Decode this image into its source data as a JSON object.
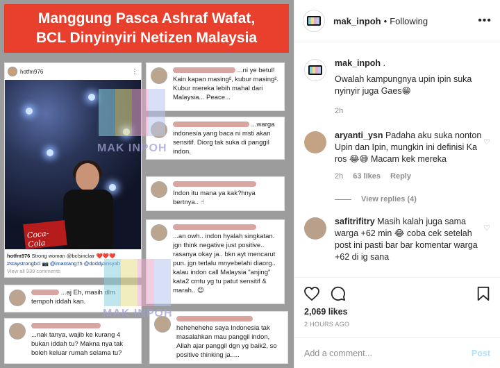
{
  "banner": {
    "line1": "Manggung Pasca Ashraf Wafat,",
    "line2": "BCL Dinyinyiri Netizen Malaysia"
  },
  "embedded_post": {
    "username": "hotfm976",
    "caption_user": "hotfm976",
    "caption_text": "Strong woman @bclsinclair ❤️❤️❤️",
    "caption_tags": "#staystrongbcl 📷 @imantang75 @doddyansyah",
    "view_all": "View all 939 comments",
    "brand_text": "Coca-Cola"
  },
  "embedded_comments": [
    {
      "text": "...ni ye betul! Kain kapan masing², kubur masing². Kubur mereka lebih mahal dari Malaysia... Peace..."
    },
    {
      "text": "...warga indonesia yang baca ni msti akan sensitif. Diorg tak suka di panggil indon."
    },
    {
      "text": "Indon itu mana ya kak?hnya bertnya.. ☝"
    },
    {
      "text": "...an owh.. indon hyalah singkatan. jgn think negative just positive.. rasanya okay ja.. bkn ayt mencarut pun. jgn terlalu mnyebelahi diaorg.. kalau indon call Malaysia \"anjing\" kata2 cmtu yg tu patut sensitif & marah.. 😊"
    },
    {
      "text": "...aj Eh, masih dlm tempoh iddah kan."
    },
    {
      "text": "...nak tanya, wajib ke kurang 4 bukan iddah tu? Makna nya tak boleh keluar rumah selama tu?"
    },
    {
      "text": "hehehehehe saya Indonesia tak masalahkan mau panggil indon, Allah ajar panggil dgn yg baik2, so positive thinking ja....."
    }
  ],
  "watermark": "MAK INPOH",
  "watermark_colors": [
    "#8bd0e0",
    "#e9e08a",
    "#e8a8c8",
    "#b8c8f0"
  ],
  "header": {
    "username": "mak_inpoh",
    "separator": "•",
    "follow_status": "Following",
    "more": "•••"
  },
  "comments": [
    {
      "username": "mak_inpoh",
      "lines": [
        ".",
        "Owalah kampungnya upin ipin suka nyinyir juga Gaes😁"
      ],
      "time": "2h",
      "owner": true
    },
    {
      "username": "aryanti_ysn",
      "text": "Padaha aku suka nonton Upin dan Ipin, mungkin ini definisi Ka ros 😂😅 Macam kek mereka",
      "time": "2h",
      "likes": "63 likes",
      "reply": "Reply",
      "view_replies": "View replies (4)"
    },
    {
      "username": "safitrifitry",
      "text": "Masih kalah juga sama warga +62 min 😂 coba cek setelah post ini pasti bar bar komentar warga +62 di ig sana"
    }
  ],
  "actions": {
    "likes": "2,069 likes",
    "time": "2 HOURS AGO"
  },
  "add_comment": {
    "placeholder": "Add a comment...",
    "post_label": "Post"
  },
  "colors": {
    "banner_red": "#e8402c",
    "post_button": "#b2dffc",
    "meta_gray": "#8e8e8e"
  }
}
